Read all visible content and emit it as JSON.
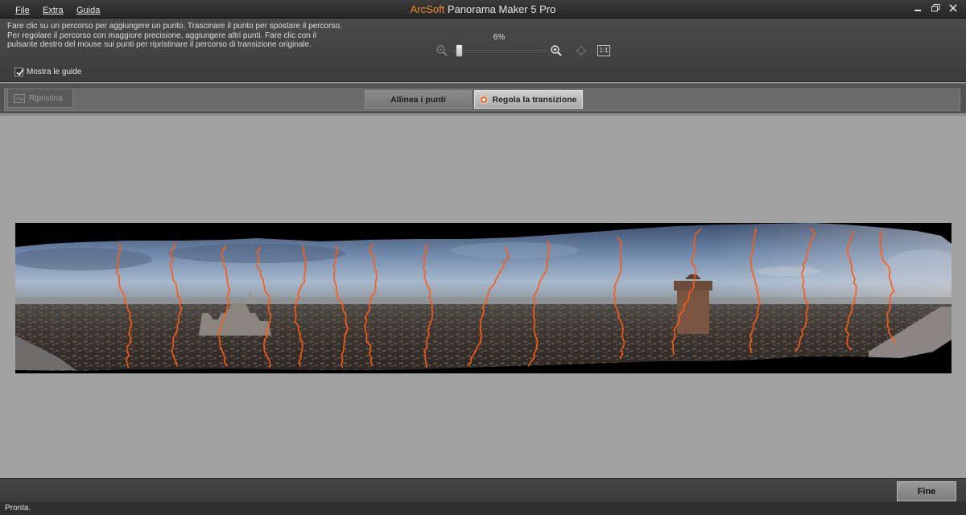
{
  "menu": [
    {
      "label": "File"
    },
    {
      "label": "Extra"
    },
    {
      "label": "Guida"
    }
  ],
  "title": {
    "brand": "ArcSoft",
    "product": "Panorama Maker 5 Pro"
  },
  "window_controls": [
    "minimize-icon",
    "restore-icon",
    "close-icon"
  ],
  "instructions": [
    "Fare clic su un percorso per aggiungere un punto. Trascinare il punto per spostare il percorso.",
    "Per regolare il percorso con maggiore precisione, aggiungere altri punti. Fare clic con il",
    "pulsante destro del mouse sui punti per ripristinare il percorso di transizione originale."
  ],
  "show_guides": {
    "label": "Mostra le guide",
    "checked": true
  },
  "zoom": {
    "value_text": "6%",
    "level": 0.06
  },
  "icons": {
    "zoom_out": "zoom-out-icon",
    "zoom_in": "zoom-in-icon",
    "fit": "fit-to-window-icon",
    "actual_size": "actual-size-icon",
    "actual_size_text": "1:1"
  },
  "toolbar": {
    "reset_label": "Ripristina",
    "align_label": "Allinea i punti",
    "transition_label": "Regola la transizione",
    "active_mode": "transition"
  },
  "colors": {
    "accent": "#f08a24",
    "seam": "#ff5a14",
    "active_dot": "#e85a1f"
  },
  "footer": {
    "done_label": "Fine"
  },
  "status": {
    "text": "Pronta."
  }
}
